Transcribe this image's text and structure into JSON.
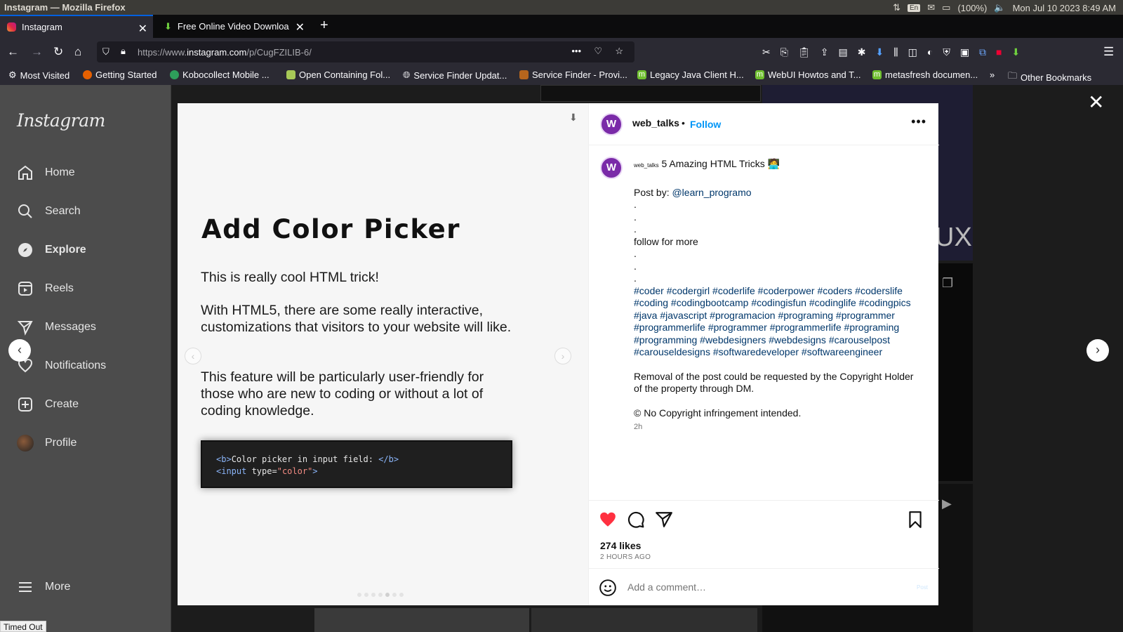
{
  "os": {
    "window_title": "Instagram — Mozilla Firefox",
    "lang": "En",
    "battery": "(100%)",
    "datetime": "Mon Jul 10 2023  8:49 AM"
  },
  "tabs": [
    {
      "label": "Instagram"
    },
    {
      "label": "Free Online Video Downloa"
    }
  ],
  "url": {
    "prefix": "https://www.",
    "host": "instagram.com",
    "path": "/p/CugFZILIB-6/"
  },
  "bookmarks": [
    {
      "label": "Most Visited"
    },
    {
      "label": "Getting Started"
    },
    {
      "label": "Kobocollect Mobile ..."
    },
    {
      "label": "Open Containing Fol..."
    },
    {
      "label": "Service Finder Updat..."
    },
    {
      "label": "Service Finder - Provi..."
    },
    {
      "label": "Legacy Java Client H..."
    },
    {
      "label": "WebUI Howtos and T..."
    },
    {
      "label": "metasfresh documen..."
    },
    {
      "label": "Other Bookmarks"
    }
  ],
  "sidebar": {
    "logo": "Instagram",
    "items": [
      {
        "label": "Home"
      },
      {
        "label": "Search"
      },
      {
        "label": "Explore"
      },
      {
        "label": "Reels"
      },
      {
        "label": "Messages"
      },
      {
        "label": "Notifications"
      },
      {
        "label": "Create"
      },
      {
        "label": "Profile"
      }
    ],
    "more": "More"
  },
  "background": {
    "tile_text": "UX"
  },
  "slide": {
    "title": "Add Color Picker",
    "p1": "This is really cool HTML trick!",
    "p2": "With HTML5, there are some really interactive, customizations that visitors to your website will like.",
    "p3": "This feature will be particularly user-friendly for those who are new to coding or without a lot of coding knowledge.",
    "code": {
      "line1_open": "<b>",
      "line1_text": "Color picker in input field: ",
      "line1_close": "</b>",
      "line2_tag": "<input",
      "line2_attr": " type=",
      "line2_val": "\"color\"",
      "line2_end": ">"
    }
  },
  "post": {
    "avatar_letter": "W",
    "username": "web_talks",
    "separator": "•",
    "follow": "Follow",
    "caption_user": "web_talks",
    "caption_title": "5 Amazing HTML Tricks 🧑‍💻",
    "post_by_label": "Post by: ",
    "post_by_handle": "@learn_programo",
    "dot": ".",
    "follow_more": "follow for more",
    "hashtags": "#coder #codergirl #coderlife #coderpower #coders #coderslife #coding #codingbootcamp #codingisfun #codinglife #codingpics #java #javascript #programacion #programing #programmer #programmerlife #programmer #programmerlife #programing #programming #webdesigners #webdesigns #carouselpost #carouseldesigns #softwaredeveloper #softwareengineer",
    "removal": "Removal of the post could be requested by the Copyright Holder of the property through DM.",
    "copyright": "© No Copyright infringement intended.",
    "time": "2h",
    "likes": "274 likes",
    "ago": "2 HOURS AGO",
    "comment_placeholder": "Add a comment…",
    "post_label": "Post"
  },
  "status_tooltip": "Timed Out",
  "colors": {
    "accent": "#0095f6",
    "like": "#ff3040",
    "link": "#00376b",
    "brand_avatar": "#7a2aa8"
  }
}
